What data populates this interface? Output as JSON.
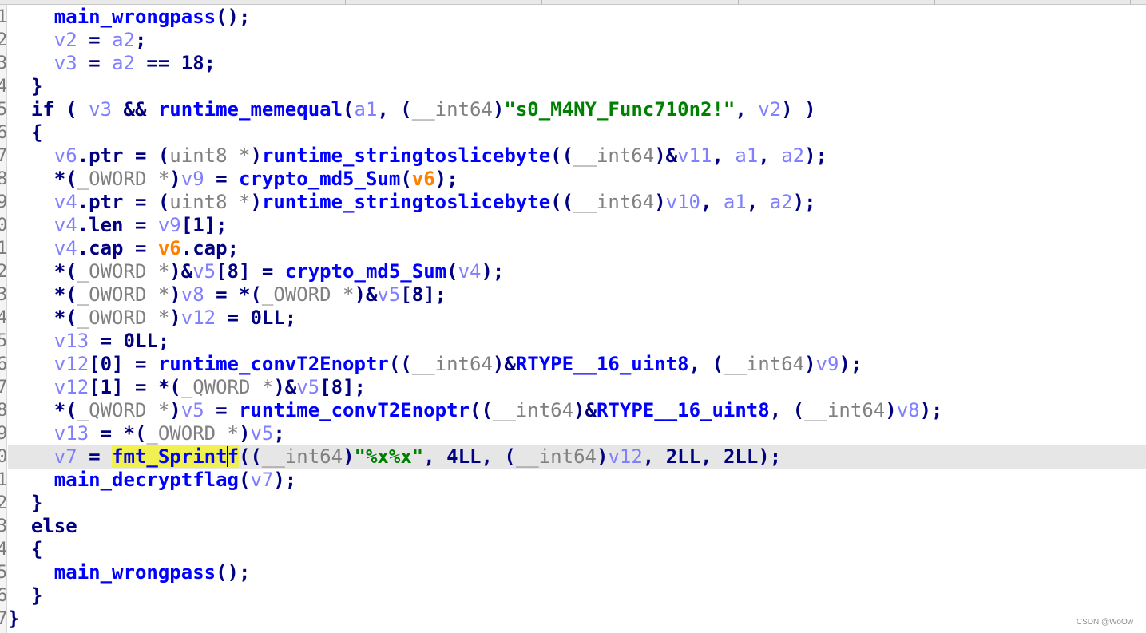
{
  "lines": [
    {
      "indent": 2,
      "current": false,
      "tokens": [
        {
          "t": "main_wrongpass",
          "k": "f"
        },
        {
          "t": "();",
          "k": "p"
        }
      ]
    },
    {
      "indent": 2,
      "current": false,
      "tokens": [
        {
          "t": "v2",
          "k": "v"
        },
        {
          "t": " = ",
          "k": "p"
        },
        {
          "t": "a2",
          "k": "v"
        },
        {
          "t": ";",
          "k": "p"
        }
      ]
    },
    {
      "indent": 2,
      "current": false,
      "tokens": [
        {
          "t": "v3",
          "k": "v"
        },
        {
          "t": " = ",
          "k": "p"
        },
        {
          "t": "a2",
          "k": "v"
        },
        {
          "t": " == 18;",
          "k": "p"
        }
      ]
    },
    {
      "indent": 1,
      "current": false,
      "tokens": [
        {
          "t": "}",
          "k": "p"
        }
      ]
    },
    {
      "indent": 1,
      "current": false,
      "tokens": [
        {
          "t": "if ( ",
          "k": "p"
        },
        {
          "t": "v3",
          "k": "v"
        },
        {
          "t": " && ",
          "k": "p"
        },
        {
          "t": "runtime_memequal",
          "k": "f"
        },
        {
          "t": "(",
          "k": "p"
        },
        {
          "t": "a1",
          "k": "v"
        },
        {
          "t": ", (",
          "k": "p"
        },
        {
          "t": "__int64",
          "k": "c"
        },
        {
          "t": ")",
          "k": "p"
        },
        {
          "t": "\"s0_M4NY_Func710n2!\"",
          "k": "s"
        },
        {
          "t": ", ",
          "k": "p"
        },
        {
          "t": "v2",
          "k": "v"
        },
        {
          "t": ") )",
          "k": "p"
        }
      ]
    },
    {
      "indent": 1,
      "current": false,
      "tokens": [
        {
          "t": "{",
          "k": "p"
        }
      ]
    },
    {
      "indent": 2,
      "current": false,
      "tokens": [
        {
          "t": "v6",
          "k": "v"
        },
        {
          "t": ".ptr = (",
          "k": "p"
        },
        {
          "t": "uint8 *",
          "k": "c"
        },
        {
          "t": ")",
          "k": "p"
        },
        {
          "t": "runtime_stringtoslicebyte",
          "k": "f"
        },
        {
          "t": "((",
          "k": "p"
        },
        {
          "t": "__int64",
          "k": "c"
        },
        {
          "t": ")&",
          "k": "p"
        },
        {
          "t": "v11",
          "k": "v"
        },
        {
          "t": ", ",
          "k": "p"
        },
        {
          "t": "a1",
          "k": "v"
        },
        {
          "t": ", ",
          "k": "p"
        },
        {
          "t": "a2",
          "k": "v"
        },
        {
          "t": ");",
          "k": "p"
        }
      ]
    },
    {
      "indent": 2,
      "current": false,
      "tokens": [
        {
          "t": "*(",
          "k": "p"
        },
        {
          "t": "_OWORD *",
          "k": "c"
        },
        {
          "t": ")",
          "k": "p"
        },
        {
          "t": "v9",
          "k": "v"
        },
        {
          "t": " = ",
          "k": "p"
        },
        {
          "t": "crypto_md5_Sum",
          "k": "f"
        },
        {
          "t": "(",
          "k": "p"
        },
        {
          "t": "v6",
          "k": "vo"
        },
        {
          "t": ");",
          "k": "p"
        }
      ]
    },
    {
      "indent": 2,
      "current": false,
      "tokens": [
        {
          "t": "v4",
          "k": "v"
        },
        {
          "t": ".ptr = (",
          "k": "p"
        },
        {
          "t": "uint8 *",
          "k": "c"
        },
        {
          "t": ")",
          "k": "p"
        },
        {
          "t": "runtime_stringtoslicebyte",
          "k": "f"
        },
        {
          "t": "((",
          "k": "p"
        },
        {
          "t": "__int64",
          "k": "c"
        },
        {
          "t": ")",
          "k": "p"
        },
        {
          "t": "v10",
          "k": "v"
        },
        {
          "t": ", ",
          "k": "p"
        },
        {
          "t": "a1",
          "k": "v"
        },
        {
          "t": ", ",
          "k": "p"
        },
        {
          "t": "a2",
          "k": "v"
        },
        {
          "t": ");",
          "k": "p"
        }
      ]
    },
    {
      "indent": 2,
      "current": false,
      "tokens": [
        {
          "t": "v4",
          "k": "v"
        },
        {
          "t": ".len = ",
          "k": "p"
        },
        {
          "t": "v9",
          "k": "v"
        },
        {
          "t": "[1];",
          "k": "p"
        }
      ]
    },
    {
      "indent": 2,
      "current": false,
      "tokens": [
        {
          "t": "v4",
          "k": "v"
        },
        {
          "t": ".cap = ",
          "k": "p"
        },
        {
          "t": "v6",
          "k": "vo"
        },
        {
          "t": ".cap;",
          "k": "p"
        }
      ]
    },
    {
      "indent": 2,
      "current": false,
      "tokens": [
        {
          "t": "*(",
          "k": "p"
        },
        {
          "t": "_OWORD *",
          "k": "c"
        },
        {
          "t": ")&",
          "k": "p"
        },
        {
          "t": "v5",
          "k": "v"
        },
        {
          "t": "[8] = ",
          "k": "p"
        },
        {
          "t": "crypto_md5_Sum",
          "k": "f"
        },
        {
          "t": "(",
          "k": "p"
        },
        {
          "t": "v4",
          "k": "v"
        },
        {
          "t": ");",
          "k": "p"
        }
      ]
    },
    {
      "indent": 2,
      "current": false,
      "tokens": [
        {
          "t": "*(",
          "k": "p"
        },
        {
          "t": "_OWORD *",
          "k": "c"
        },
        {
          "t": ")",
          "k": "p"
        },
        {
          "t": "v8",
          "k": "v"
        },
        {
          "t": " = *(",
          "k": "p"
        },
        {
          "t": "_OWORD *",
          "k": "c"
        },
        {
          "t": ")&",
          "k": "p"
        },
        {
          "t": "v5",
          "k": "v"
        },
        {
          "t": "[8];",
          "k": "p"
        }
      ]
    },
    {
      "indent": 2,
      "current": false,
      "tokens": [
        {
          "t": "*(",
          "k": "p"
        },
        {
          "t": "_OWORD *",
          "k": "c"
        },
        {
          "t": ")",
          "k": "p"
        },
        {
          "t": "v12",
          "k": "v"
        },
        {
          "t": " = 0LL;",
          "k": "p"
        }
      ]
    },
    {
      "indent": 2,
      "current": false,
      "tokens": [
        {
          "t": "v13",
          "k": "v"
        },
        {
          "t": " = 0LL;",
          "k": "p"
        }
      ]
    },
    {
      "indent": 2,
      "current": false,
      "tokens": [
        {
          "t": "v12",
          "k": "v"
        },
        {
          "t": "[0] = ",
          "k": "p"
        },
        {
          "t": "runtime_convT2Enoptr",
          "k": "f"
        },
        {
          "t": "((",
          "k": "p"
        },
        {
          "t": "__int64",
          "k": "c"
        },
        {
          "t": ")&",
          "k": "p"
        },
        {
          "t": "RTYPE__16_uint8",
          "k": "f"
        },
        {
          "t": ", (",
          "k": "p"
        },
        {
          "t": "__int64",
          "k": "c"
        },
        {
          "t": ")",
          "k": "p"
        },
        {
          "t": "v9",
          "k": "v"
        },
        {
          "t": ");",
          "k": "p"
        }
      ]
    },
    {
      "indent": 2,
      "current": false,
      "tokens": [
        {
          "t": "v12",
          "k": "v"
        },
        {
          "t": "[1] = *(",
          "k": "p"
        },
        {
          "t": "_QWORD *",
          "k": "c"
        },
        {
          "t": ")&",
          "k": "p"
        },
        {
          "t": "v5",
          "k": "v"
        },
        {
          "t": "[8];",
          "k": "p"
        }
      ]
    },
    {
      "indent": 2,
      "current": false,
      "tokens": [
        {
          "t": "*(",
          "k": "p"
        },
        {
          "t": "_QWORD *",
          "k": "c"
        },
        {
          "t": ")",
          "k": "p"
        },
        {
          "t": "v5",
          "k": "v"
        },
        {
          "t": " = ",
          "k": "p"
        },
        {
          "t": "runtime_convT2Enoptr",
          "k": "f"
        },
        {
          "t": "((",
          "k": "p"
        },
        {
          "t": "__int64",
          "k": "c"
        },
        {
          "t": ")&",
          "k": "p"
        },
        {
          "t": "RTYPE__16_uint8",
          "k": "f"
        },
        {
          "t": ", (",
          "k": "p"
        },
        {
          "t": "__int64",
          "k": "c"
        },
        {
          "t": ")",
          "k": "p"
        },
        {
          "t": "v8",
          "k": "v"
        },
        {
          "t": ");",
          "k": "p"
        }
      ]
    },
    {
      "indent": 2,
      "current": false,
      "tokens": [
        {
          "t": "v13",
          "k": "v"
        },
        {
          "t": " = *(",
          "k": "p"
        },
        {
          "t": "_OWORD *",
          "k": "c"
        },
        {
          "t": ")",
          "k": "p"
        },
        {
          "t": "v5",
          "k": "v"
        },
        {
          "t": ";",
          "k": "p"
        }
      ]
    },
    {
      "indent": 2,
      "current": true,
      "tokens": [
        {
          "t": "v7",
          "k": "v"
        },
        {
          "t": " = ",
          "k": "p"
        },
        {
          "t": "fmt_Sprint",
          "k": "hl"
        },
        {
          "t": "",
          "k": "caret"
        },
        {
          "t": "f",
          "k": "hl"
        },
        {
          "t": "((",
          "k": "p"
        },
        {
          "t": "__int64",
          "k": "c"
        },
        {
          "t": ")",
          "k": "p"
        },
        {
          "t": "\"%x%x\"",
          "k": "s"
        },
        {
          "t": ", 4LL, (",
          "k": "p"
        },
        {
          "t": "__int64",
          "k": "c"
        },
        {
          "t": ")",
          "k": "p"
        },
        {
          "t": "v12",
          "k": "v"
        },
        {
          "t": ", 2LL, 2LL);",
          "k": "p"
        }
      ]
    },
    {
      "indent": 2,
      "current": false,
      "tokens": [
        {
          "t": "main_decryptflag",
          "k": "f"
        },
        {
          "t": "(",
          "k": "p"
        },
        {
          "t": "v7",
          "k": "v"
        },
        {
          "t": ");",
          "k": "p"
        }
      ]
    },
    {
      "indent": 1,
      "current": false,
      "tokens": [
        {
          "t": "}",
          "k": "p"
        }
      ]
    },
    {
      "indent": 1,
      "current": false,
      "tokens": [
        {
          "t": "else",
          "k": "p"
        }
      ]
    },
    {
      "indent": 1,
      "current": false,
      "tokens": [
        {
          "t": "{",
          "k": "p"
        }
      ]
    },
    {
      "indent": 2,
      "current": false,
      "tokens": [
        {
          "t": "main_wrongpass",
          "k": "f"
        },
        {
          "t": "();",
          "k": "p"
        }
      ]
    },
    {
      "indent": 1,
      "current": false,
      "tokens": [
        {
          "t": "}",
          "k": "p"
        }
      ]
    },
    {
      "indent": 0,
      "current": false,
      "tokens": [
        {
          "t": "}",
          "k": "p"
        }
      ]
    }
  ],
  "gutter_digits": [
    "1",
    "2",
    "3",
    "4",
    "5",
    "6",
    "7",
    "8",
    "9",
    "0",
    "1",
    "2",
    "3",
    "4",
    "5",
    "6",
    "7",
    "8",
    "9",
    "0",
    "1",
    "2",
    "3",
    "4",
    "5",
    "6",
    "7"
  ],
  "watermark": "CSDN @WoOw",
  "colors": {
    "function": "#0000ff",
    "variable": "#8080ff",
    "modified_variable": "#ff8000",
    "type_cast": "#808080",
    "string": "#008000",
    "punctuation": "#000080",
    "current_line": "#e6e6e6",
    "highlight": "#f0f050"
  }
}
